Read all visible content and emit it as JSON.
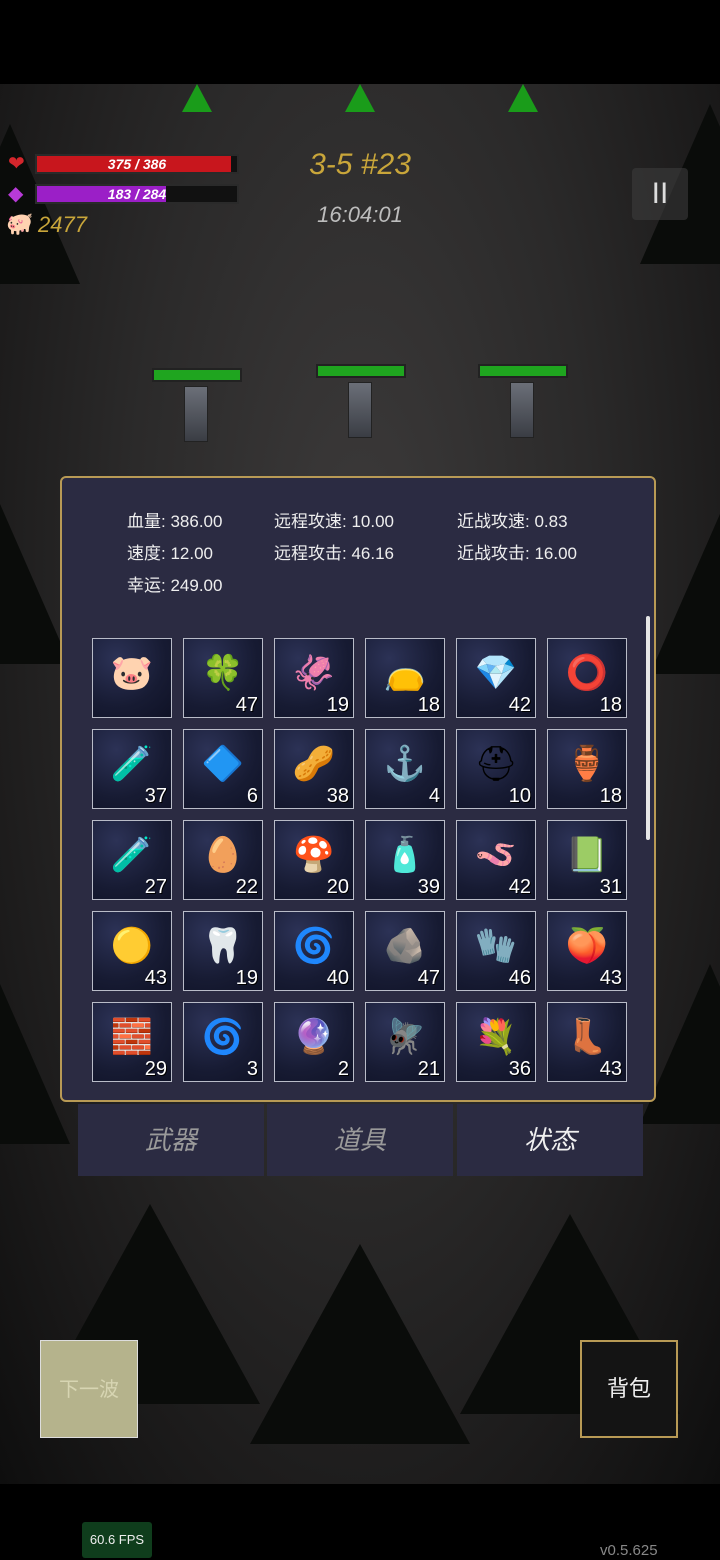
{
  "hud": {
    "hp": {
      "current": 375,
      "max": 386,
      "text": "375 / 386",
      "color": "#c8161d"
    },
    "mp": {
      "current": 183,
      "max": 284,
      "text": "183 / 284",
      "color": "#9b1fc7"
    },
    "gold": "2477",
    "level": "3-5 #23",
    "clock": "16:04:01",
    "pause_symbol": "II"
  },
  "stats": [
    {
      "label": "血量:",
      "value": "386.00"
    },
    {
      "label": "远程攻速:",
      "value": "10.00"
    },
    {
      "label": "近战攻速:",
      "value": "0.83"
    },
    {
      "label": "速度:",
      "value": "12.00"
    },
    {
      "label": "远程攻击:",
      "value": "46.16"
    },
    {
      "label": "近战攻击:",
      "value": "16.00"
    },
    {
      "label": "幸运:",
      "value": "249.00"
    }
  ],
  "items": [
    {
      "icon": "piggy-bank-icon",
      "glyph": "🐷",
      "count": ""
    },
    {
      "icon": "clover-icon",
      "glyph": "🍀",
      "count": "47"
    },
    {
      "icon": "squid-icon",
      "glyph": "🦑",
      "count": "19"
    },
    {
      "icon": "sack-icon",
      "glyph": "👝",
      "count": "18"
    },
    {
      "icon": "crystal-rock-icon",
      "glyph": "💎",
      "count": "42"
    },
    {
      "icon": "metal-ring-icon",
      "glyph": "⭕",
      "count": "18"
    },
    {
      "icon": "blue-potion-icon",
      "glyph": "🧪",
      "count": "37"
    },
    {
      "icon": "diamond-tile-icon",
      "glyph": "🔷",
      "count": "6"
    },
    {
      "icon": "seeds-icon",
      "glyph": "🥜",
      "count": "38"
    },
    {
      "icon": "hook-icon",
      "glyph": "⚓",
      "count": "4"
    },
    {
      "icon": "medkit-icon",
      "glyph": "⛑",
      "count": "10"
    },
    {
      "icon": "fire-jar-icon",
      "glyph": "🏺",
      "count": "18"
    },
    {
      "icon": "green-potion-icon",
      "glyph": "🧪",
      "count": "27"
    },
    {
      "icon": "egg-sack-icon",
      "glyph": "🥚",
      "count": "22"
    },
    {
      "icon": "mushroom-icon",
      "glyph": "🍄",
      "count": "20"
    },
    {
      "icon": "vial-icon",
      "glyph": "🧴",
      "count": "39"
    },
    {
      "icon": "worm-icon",
      "glyph": "🪱",
      "count": "42"
    },
    {
      "icon": "skull-book-icon",
      "glyph": "📗",
      "count": "31"
    },
    {
      "icon": "gold-coin-icon",
      "glyph": "🟡",
      "count": "43"
    },
    {
      "icon": "fang-icon",
      "glyph": "🦷",
      "count": "19"
    },
    {
      "icon": "thorn-crown-icon",
      "glyph": "🌀",
      "count": "40"
    },
    {
      "icon": "silver-ore-icon",
      "glyph": "🪨",
      "count": "47"
    },
    {
      "icon": "gloves-icon",
      "glyph": "🧤",
      "count": "46"
    },
    {
      "icon": "peach-icon",
      "glyph": "🍑",
      "count": "43"
    },
    {
      "icon": "ore-chunks-icon",
      "glyph": "🧱",
      "count": "29"
    },
    {
      "icon": "purple-swirl-rune-icon",
      "glyph": "🌀",
      "count": "3"
    },
    {
      "icon": "purple-eye-rune-icon",
      "glyph": "🔮",
      "count": "2"
    },
    {
      "icon": "dragonfly-icon",
      "glyph": "🪰",
      "count": "21"
    },
    {
      "icon": "flower-wreath-icon",
      "glyph": "💐",
      "count": "36"
    },
    {
      "icon": "boots-icon",
      "glyph": "👢",
      "count": "43"
    }
  ],
  "tabs": [
    "武器",
    "道具",
    "状态"
  ],
  "buttons": {
    "next_wave": "下一波",
    "bag": "背包"
  },
  "fps": "60.6 FPS",
  "version": "v0.5.625"
}
